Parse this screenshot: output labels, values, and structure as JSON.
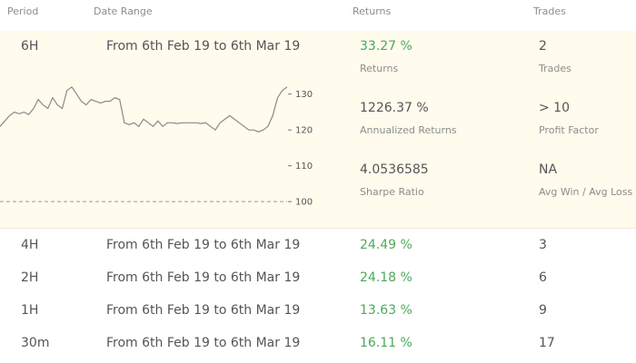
{
  "header": {
    "period": "Period",
    "date_range": "Date Range",
    "returns": "Returns",
    "trades": "Trades"
  },
  "expanded": {
    "period": "6H",
    "date_range": "From 6th Feb 19 to 6th Mar 19",
    "returns_value": "33.27 %",
    "returns_label": "Returns",
    "trades_value": "2",
    "trades_label": "Trades",
    "annualized_value": "1226.37 %",
    "annualized_label": "Annualized Returns",
    "profit_factor_value": "> 10",
    "profit_factor_label": "Profit Factor",
    "sharpe_value": "4.0536585",
    "sharpe_label": "Sharpe Ratio",
    "avg_win_loss_value": "NA",
    "avg_win_loss_label": "Avg Win / Avg Loss"
  },
  "chart_data": {
    "type": "line",
    "title": "",
    "xlabel": "",
    "ylabel": "",
    "ylim": [
      97,
      135
    ],
    "y_ticks": [
      "130",
      "120",
      "110",
      "100"
    ],
    "y_tick_values": [
      130,
      120,
      110,
      100
    ],
    "baseline": 100,
    "x": [
      0,
      1,
      2,
      3,
      4,
      5,
      6,
      7,
      8,
      9,
      10,
      11,
      12,
      13,
      14,
      15,
      16,
      17,
      18,
      19,
      20,
      21,
      22,
      23,
      24,
      25,
      26,
      27,
      28,
      29,
      30,
      31,
      32,
      33,
      34,
      35,
      36,
      37,
      38,
      39,
      40,
      41,
      42,
      43,
      44,
      45,
      46,
      47,
      48,
      49,
      50,
      51,
      52,
      53,
      54,
      55,
      56,
      57,
      58,
      59,
      60
    ],
    "series": [
      {
        "values": [
          121,
          122.5,
          124,
          125,
          124.5,
          125,
          124.3,
          126,
          128.5,
          127,
          126,
          129,
          127,
          126,
          131,
          132,
          130,
          128,
          127,
          128.5,
          128,
          127.5,
          128,
          128,
          129,
          128.5,
          122,
          121.5,
          122,
          121,
          123,
          122,
          121,
          122.5,
          121,
          122,
          122,
          121.8,
          122,
          122,
          122,
          122,
          121.8,
          122,
          121,
          120,
          122,
          123,
          124,
          123,
          122,
          121,
          120,
          120,
          119.5,
          120,
          121,
          124,
          129,
          131,
          132
        ]
      }
    ]
  },
  "rows": [
    {
      "period": "4H",
      "date_range": "From 6th Feb 19 to 6th Mar 19",
      "returns": "24.49 %",
      "trades": "3"
    },
    {
      "period": "2H",
      "date_range": "From 6th Feb 19 to 6th Mar 19",
      "returns": "24.18 %",
      "trades": "6"
    },
    {
      "period": "1H",
      "date_range": "From 6th Feb 19 to 6th Mar 19",
      "returns": "13.63 %",
      "trades": "9"
    },
    {
      "period": "30m",
      "date_range": "From 6th Feb 19 to 6th Mar 19",
      "returns": "16.11 %",
      "trades": "17"
    }
  ],
  "colors": {
    "positive": "#4ea85a",
    "highlight_bg": "#fffbed",
    "chart_line": "#8a8a8a"
  }
}
